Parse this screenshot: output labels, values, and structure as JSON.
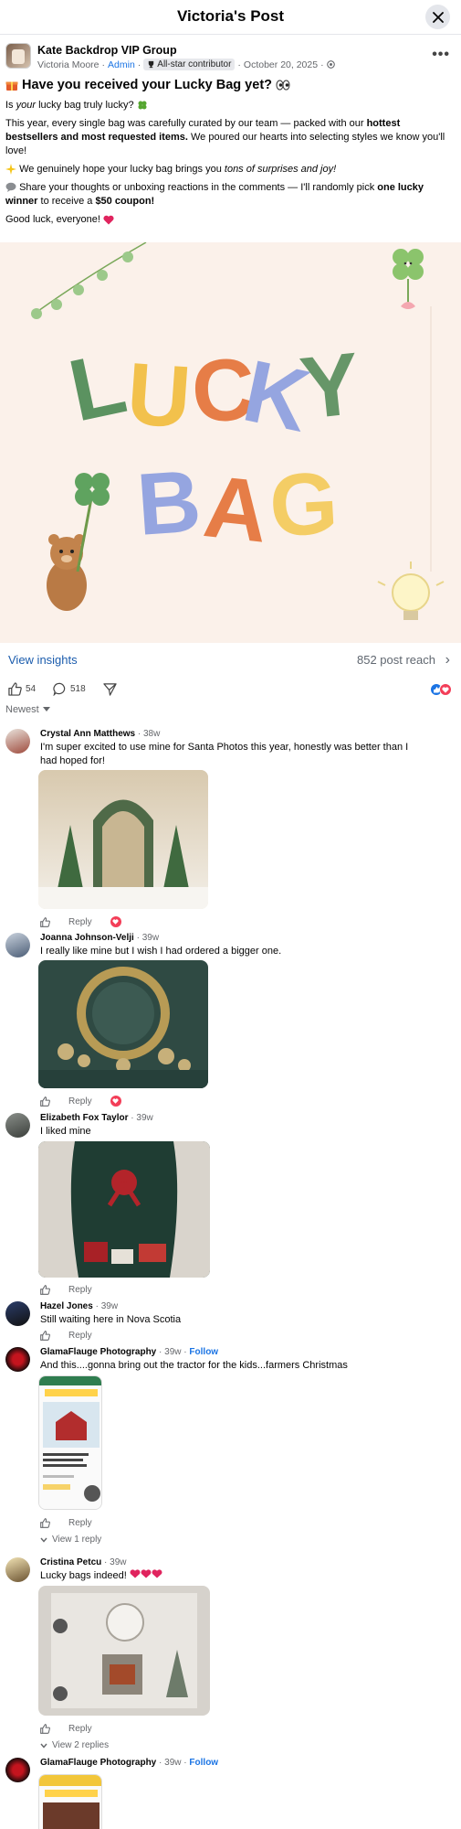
{
  "header": {
    "title": "Victoria's Post"
  },
  "post": {
    "group_name": "Kate Backdrop VIP Group",
    "author": "Victoria Moore",
    "role": "Admin",
    "badge": "All-star contributor",
    "date": "October 20, 2025",
    "title": "Have you received your Lucky Bag yet?",
    "p1_pre": "Is ",
    "p1_em": "your",
    "p1_post": " lucky bag truly lucky?",
    "p2_pre": "This year, every single bag was carefully curated by our team — packed with our ",
    "p2_bold": "hottest bestsellers and most requested items.",
    "p2_post": " We poured our hearts into selecting styles we know you'll love!",
    "p3_pre": "We genuinely hope your lucky bag brings you ",
    "p3_em": "tons of surprises and joy!",
    "p4_pre": "Share your thoughts or unboxing reactions in the comments — I'll randomly pick ",
    "p4_bold1": "one lucky winner",
    "p4_mid": " to receive a ",
    "p4_bold2": "$50 coupon!",
    "p5": "Good luck, everyone!",
    "hero_word1": "LUCKY",
    "hero_word2": "BAG"
  },
  "insights": {
    "link": "View insights",
    "reach": "852 post reach"
  },
  "actions": {
    "likes": "54",
    "comments": "518"
  },
  "sort": {
    "label": "Newest"
  },
  "comments": [
    {
      "name": "Crystal Ann Matthews",
      "time": "38w",
      "text": "I'm super excited to use mine for Santa Photos this year, honestly was better than I had hoped for!",
      "reply": "Reply"
    },
    {
      "name": "Joanna Johnson-Velji",
      "time": "39w",
      "text": "I really like mine but I wish I had ordered a bigger one.",
      "reply": "Reply"
    },
    {
      "name": "Elizabeth Fox Taylor",
      "time": "39w",
      "text": "I liked mine",
      "reply": "Reply"
    },
    {
      "name": "Hazel Jones",
      "time": "39w",
      "text": "Still waiting here in Nova Scotia",
      "reply": "Reply"
    },
    {
      "name": "GlamaFlauge Photography",
      "time": "39w",
      "follow": "Follow",
      "text": "And this....gonna bring out the tractor for the kids...farmers Christmas",
      "reply": "Reply",
      "view_replies": "View 1 reply"
    },
    {
      "name": "Cristina Petcu",
      "time": "39w",
      "text": "Lucky bags indeed!",
      "reply": "Reply",
      "view_replies": "View 2 replies"
    },
    {
      "name": "GlamaFlauge Photography",
      "time": "39w",
      "follow": "Follow"
    }
  ],
  "separator": "·",
  "colors": {
    "accent": "#1b74e4",
    "insight_link": "#1b5cad",
    "heart": "#f33e58"
  },
  "icons": [
    "close-icon",
    "more-icon",
    "gift-icon",
    "eyes-icon",
    "clover-icon",
    "sparkle-icon",
    "speech-icon",
    "heart-icon",
    "trophy-icon",
    "globe-icon",
    "like-icon",
    "comment-icon",
    "share-icon",
    "chevron-right-icon",
    "chevron-down-icon"
  ]
}
